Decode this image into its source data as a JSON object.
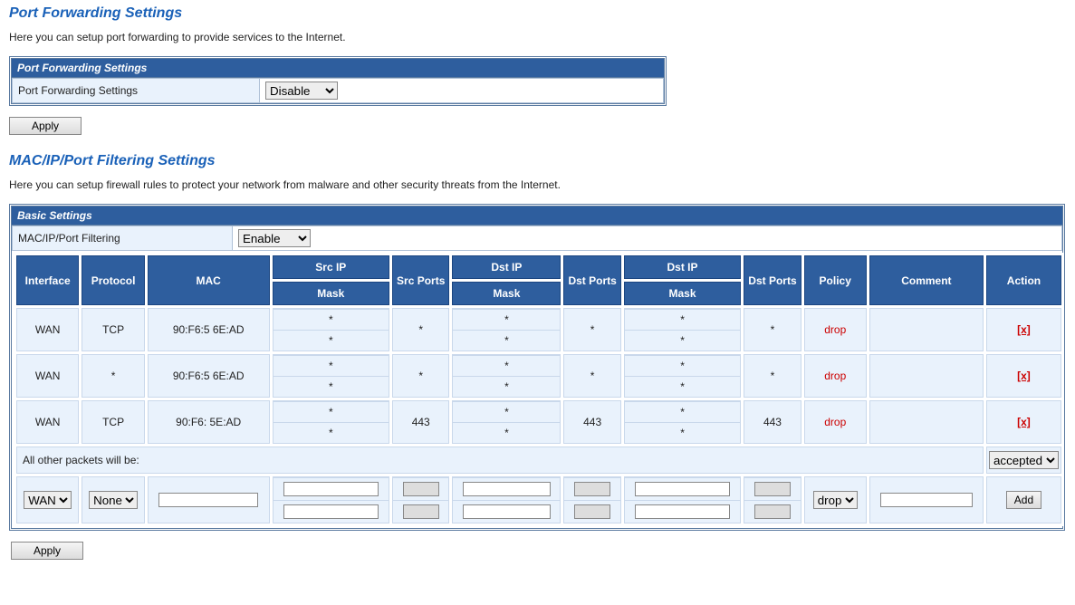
{
  "pf": {
    "title": "Port Forwarding Settings",
    "desc": "Here you can setup port forwarding to provide services to the Internet.",
    "panel_title": "Port Forwarding Settings",
    "row_label": "Port Forwarding Settings",
    "select_value": "Disable",
    "apply": "Apply"
  },
  "filter": {
    "title": "MAC/IP/Port Filtering Settings",
    "desc": "Here you can setup firewall rules to protect your network from malware and other security threats from the Internet.",
    "panel_title": "Basic Settings",
    "row_label": "MAC/IP/Port Filtering",
    "select_value": "Enable",
    "apply": "Apply",
    "other_packets_label": "All other packets will be:",
    "other_packets_value": "accepted",
    "add_label": "Add",
    "add_row": {
      "interface": "WAN",
      "protocol": "None",
      "policy": "drop"
    },
    "headers": {
      "interface": "Interface",
      "protocol": "Protocol",
      "mac": "MAC",
      "srcip": "Src IP",
      "mask": "Mask",
      "srcports": "Src Ports",
      "dstip": "Dst IP",
      "dstports": "Dst Ports",
      "policy": "Policy",
      "comment": "Comment",
      "action": "Action"
    },
    "rules": [
      {
        "interface": "WAN",
        "protocol": "TCP",
        "mac": "90:F6:5       6E:AD",
        "srcip": "*",
        "srcmask": "*",
        "srcports": "*",
        "dstip1": "*",
        "dstmask1": "*",
        "dstports1": "*",
        "dstip2": "*",
        "dstmask2": "*",
        "dstports2": "*",
        "policy": "drop",
        "comment": "",
        "action": "[x]"
      },
      {
        "interface": "WAN",
        "protocol": "*",
        "mac": "90:F6:5       6E:AD",
        "srcip": "*",
        "srcmask": "*",
        "srcports": "*",
        "dstip1": "*",
        "dstmask1": "*",
        "dstports1": "*",
        "dstip2": "*",
        "dstmask2": "*",
        "dstports2": "*",
        "policy": "drop",
        "comment": "",
        "action": "[x]"
      },
      {
        "interface": "WAN",
        "protocol": "TCP",
        "mac": "90:F6:         5E:AD",
        "srcip": "*",
        "srcmask": "*",
        "srcports": "443",
        "dstip1": "*",
        "dstmask1": "*",
        "dstports1": "443",
        "dstip2": "*",
        "dstmask2": "*",
        "dstports2": "443",
        "policy": "drop",
        "comment": "",
        "action": "[x]"
      }
    ]
  }
}
